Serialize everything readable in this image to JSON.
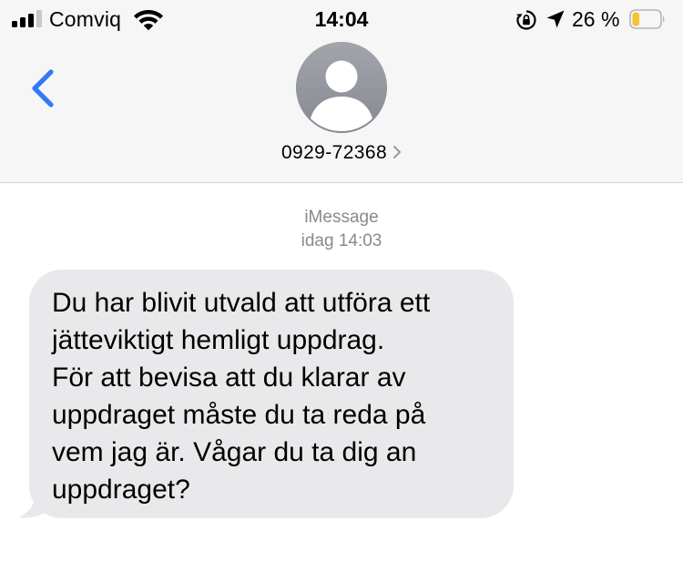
{
  "status_bar": {
    "carrier": "Comviq",
    "time": "14:04",
    "battery_percent": "26 %",
    "battery_level": 0.26,
    "signal_bars_active": 3,
    "icons": [
      "signal-icon",
      "wifi-icon",
      "rotation-lock-icon",
      "location-arrow-icon",
      "battery-icon"
    ]
  },
  "header": {
    "contact_name": "0929-72368",
    "back_icon": "chevron-left-icon",
    "avatar_icon": "person-silhouette-icon",
    "name_chevron_icon": "chevron-right-icon"
  },
  "conversation": {
    "service": "iMessage",
    "timestamp": "idag 14:03",
    "messages": [
      {
        "direction": "incoming",
        "text": "Du har blivit utvald att utföra ett\njätteviktigt hemligt uppdrag.\nFör att bevisa att du klarar av\nuppdraget måste du ta reda på\nvem jag är. Vågar du ta dig an\nuppdraget?"
      }
    ]
  },
  "colors": {
    "accent": "#3478f6",
    "bubble_incoming": "#e9e9eb",
    "header_bg": "#f6f6f6",
    "secondary_text": "#8a8a8e",
    "avatar_bg": "#8e8e93",
    "battery_fill": "#f4c331"
  }
}
